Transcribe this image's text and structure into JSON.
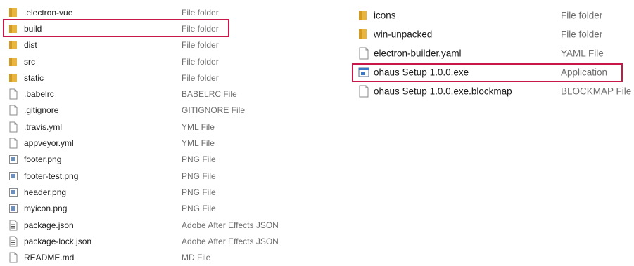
{
  "left_pane": {
    "items": [
      {
        "name": ".electron-vue",
        "type": "File folder",
        "icon": "folder-icon"
      },
      {
        "name": "build",
        "type": "File folder",
        "icon": "folder-icon"
      },
      {
        "name": "dist",
        "type": "File folder",
        "icon": "folder-icon"
      },
      {
        "name": "src",
        "type": "File folder",
        "icon": "folder-icon"
      },
      {
        "name": "static",
        "type": "File folder",
        "icon": "folder-icon"
      },
      {
        "name": ".babelrc",
        "type": "BABELRC File",
        "icon": "file-icon"
      },
      {
        "name": ".gitignore",
        "type": "GITIGNORE File",
        "icon": "file-icon"
      },
      {
        "name": ".travis.yml",
        "type": "YML File",
        "icon": "file-icon"
      },
      {
        "name": "appveyor.yml",
        "type": "YML File",
        "icon": "file-icon"
      },
      {
        "name": "footer.png",
        "type": "PNG File",
        "icon": "image-file-icon"
      },
      {
        "name": "footer-test.png",
        "type": "PNG File",
        "icon": "image-file-icon"
      },
      {
        "name": "header.png",
        "type": "PNG File",
        "icon": "image-file-icon"
      },
      {
        "name": "myicon.png",
        "type": "PNG File",
        "icon": "image-file-icon"
      },
      {
        "name": "package.json",
        "type": "Adobe After Effects JSON",
        "icon": "json-file-icon"
      },
      {
        "name": "package-lock.json",
        "type": "Adobe After Effects JSON",
        "icon": "json-file-icon"
      },
      {
        "name": "README.md",
        "type": "MD File",
        "icon": "file-icon"
      }
    ]
  },
  "right_pane": {
    "items": [
      {
        "name": "icons",
        "type": "File folder",
        "icon": "folder-icon"
      },
      {
        "name": "win-unpacked",
        "type": "File folder",
        "icon": "folder-icon"
      },
      {
        "name": "electron-builder.yaml",
        "type": "YAML File",
        "icon": "file-icon"
      },
      {
        "name": "ohaus Setup 1.0.0.exe",
        "type": "Application",
        "icon": "application-icon"
      },
      {
        "name": "ohaus Setup 1.0.0.exe.blockmap",
        "type": "BLOCKMAP File",
        "icon": "file-icon"
      }
    ]
  },
  "colors": {
    "highlight_border": "#c8184a",
    "folder": "#e8b640",
    "type_text": "#6d6d6d"
  }
}
